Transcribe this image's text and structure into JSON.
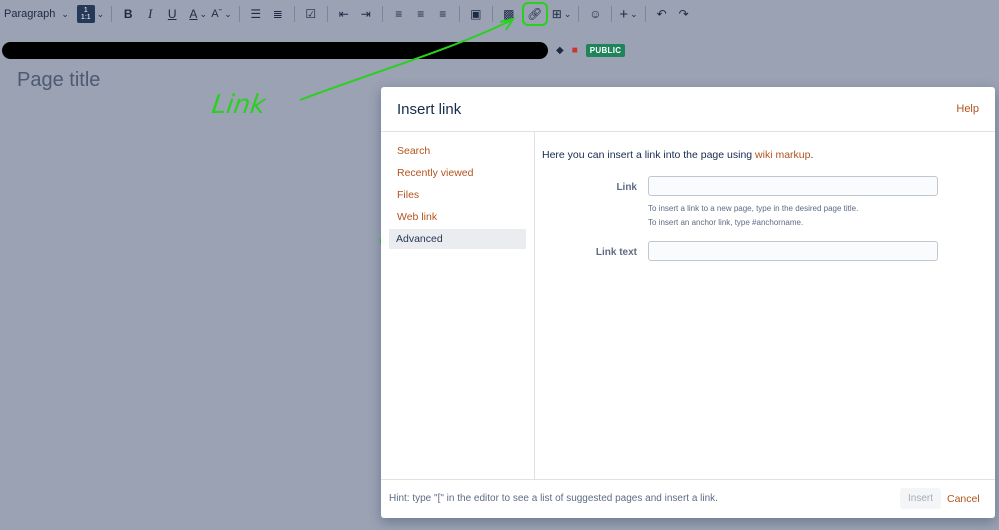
{
  "toolbar": {
    "paragraph_label": "Paragraph",
    "layout_label": "1 1:1",
    "bold_label": "B",
    "italic_label": "I",
    "underline_label": "U",
    "text_color_label": "A",
    "icons": [
      "chevron-down-icon",
      "layout-icon",
      "bold-icon",
      "italic-icon",
      "underline-icon",
      "text-color-icon",
      "text-style-icon",
      "bullet-list-icon",
      "numbered-list-icon",
      "task-icon",
      "outdent-icon",
      "indent-icon",
      "align-left-icon",
      "align-center-icon",
      "align-right-icon",
      "panel-icon",
      "image-icon",
      "link-icon",
      "table-icon",
      "emoji-icon",
      "insert-more-icon",
      "undo-icon",
      "redo-icon"
    ]
  },
  "page": {
    "badge": "PUBLIC",
    "title_placeholder": "Page title"
  },
  "annotation": {
    "text": "Link",
    "color": "#29d11d"
  },
  "dialog": {
    "title": "Insert link",
    "help": "Help",
    "nav": [
      {
        "label": "Search"
      },
      {
        "label": "Recently viewed"
      },
      {
        "label": "Files"
      },
      {
        "label": "Web link"
      },
      {
        "label": "Advanced",
        "active": true
      }
    ],
    "intro_text": "Here you can insert a link into the page using ",
    "intro_link": "wiki markup",
    "intro_end": ".",
    "link_label": "Link",
    "link_value": "",
    "link_hint_1": "To insert a link to a new page, type in the desired page title.",
    "link_hint_2": "To insert an anchor link, type #anchorname.",
    "link_text_label": "Link text",
    "link_text_value": "",
    "footer_hint": "Hint: type \"[\" in the editor to see a list of suggested pages and insert a link.",
    "insert_label": "Insert",
    "cancel_label": "Cancel"
  },
  "colors": {
    "accent_link": "#b2521e",
    "badge_green": "#1f845a",
    "overlay": "#9aa2b3"
  }
}
